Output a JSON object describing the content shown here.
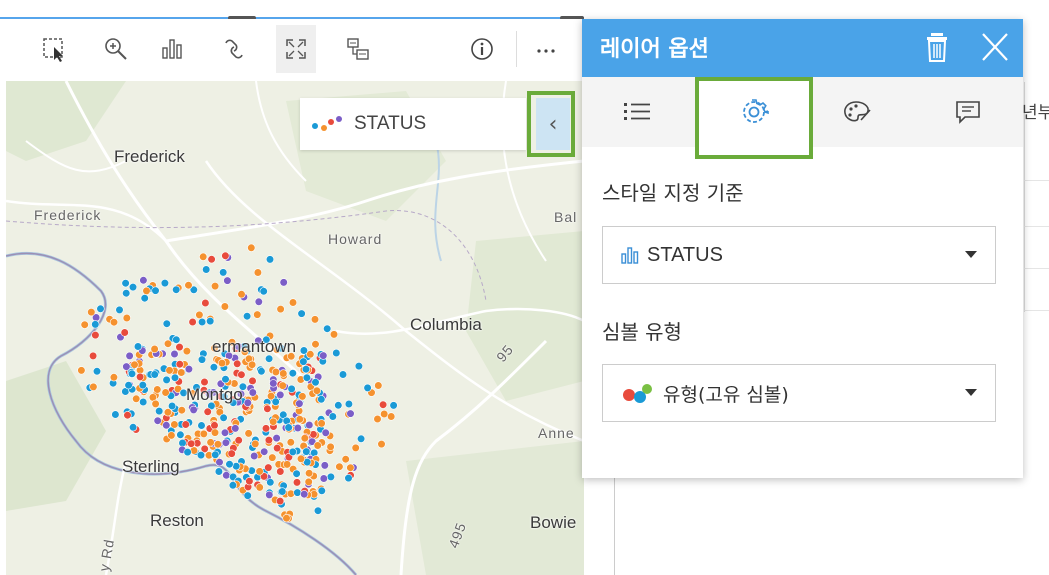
{
  "map": {
    "legend": {
      "label": "STATUS",
      "icon": "category-dots-icon"
    },
    "collapse_glyph": "‹",
    "places": [
      {
        "key": "frederick",
        "label": "Frederick"
      },
      {
        "key": "frederick_small",
        "label": "Frederick"
      },
      {
        "key": "howard",
        "label": "Howard"
      },
      {
        "key": "columbia",
        "label": "Columbia"
      },
      {
        "key": "germantown",
        "label": "ermantown"
      },
      {
        "key": "montgomery",
        "label": "Montgo"
      },
      {
        "key": "sterling",
        "label": "Sterling"
      },
      {
        "key": "reston",
        "label": "Reston"
      },
      {
        "key": "bowie",
        "label": "Bowie"
      },
      {
        "key": "balt",
        "label": "Bal"
      },
      {
        "key": "anne",
        "label": "Anne"
      },
      {
        "key": "hwy95",
        "label": "95"
      },
      {
        "key": "hwy495",
        "label": "495"
      },
      {
        "key": "dulles_rd",
        "label": "y Rd"
      }
    ],
    "toolbar": [
      "select-icon",
      "zoom-icon",
      "chart-icon",
      "link-icon",
      "expand-icon",
      "layers-icon",
      "info-icon",
      "more-icon"
    ]
  },
  "panel": {
    "title": "레이어 옵션",
    "tabs": [
      "list-icon",
      "gear-icon",
      "palette-icon",
      "comment-icon"
    ],
    "active_tab": "gear-icon",
    "style_by_label": "스타일 지정 기준",
    "style_by_value": "STATUS",
    "symbol_type_label": "심볼 유형",
    "symbol_type_value": "유형(고유 심볼)"
  },
  "peek_tab": "년부",
  "colors": {
    "header": "#4aa3e8",
    "highlight": "#6aab3a",
    "dot_orange": "#f5922f",
    "dot_blue": "#1a9ad6",
    "dot_red": "#e84b3c",
    "dot_purple": "#7b5ec7"
  }
}
